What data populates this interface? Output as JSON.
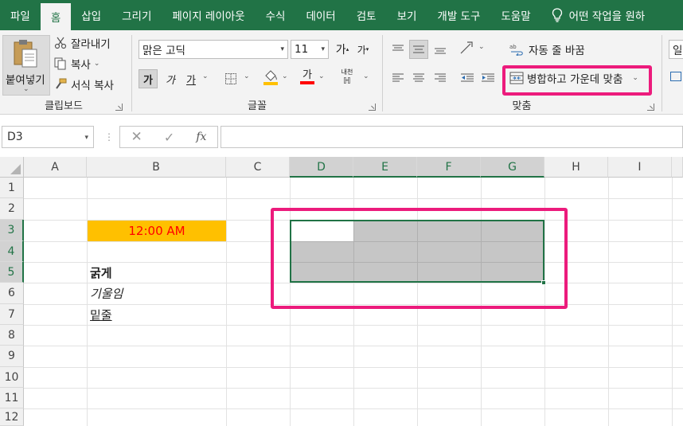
{
  "tabs": [
    {
      "label": "파일"
    },
    {
      "label": "홈",
      "active": true
    },
    {
      "label": "삽입"
    },
    {
      "label": "그리기"
    },
    {
      "label": "페이지 레이아웃"
    },
    {
      "label": "수식"
    },
    {
      "label": "데이터"
    },
    {
      "label": "검토"
    },
    {
      "label": "보기"
    },
    {
      "label": "개발 도구"
    },
    {
      "label": "도움말"
    }
  ],
  "tell_me": "어떤 작업을 원하",
  "clipboard": {
    "paste_label": "붙여넣기",
    "cut_label": "잘라내기",
    "copy_label": "복사",
    "format_painter_label": "서식 복사",
    "group_label": "클립보드"
  },
  "font": {
    "font_name": "맑은 고딕",
    "font_size": "11",
    "grow_label": "가",
    "shrink_label": "가",
    "bold_label": "가",
    "italic_label": "가",
    "underline_label": "가",
    "color_label": "가",
    "phonetic_label": "내천",
    "group_label": "글꼴"
  },
  "alignment": {
    "wrap_text_label": "자동 줄 바꿈",
    "merge_center_label": "병합하고 가운데 맞춤",
    "group_label": "맞춤"
  },
  "number_format_partial": "일",
  "formula_bar": {
    "name_box": "D3",
    "fx": "fx",
    "formula": ""
  },
  "grid": {
    "columns": [
      "A",
      "B",
      "C",
      "D",
      "E",
      "F",
      "G",
      "H",
      "I"
    ],
    "selected_columns": [
      "D",
      "E",
      "F",
      "G"
    ],
    "rows": [
      "1",
      "2",
      "3",
      "4",
      "5",
      "6",
      "7",
      "8",
      "9",
      "10",
      "11",
      "12"
    ],
    "selected_rows": [
      "3",
      "4",
      "5"
    ],
    "cells": {
      "B3": "12:00 AM",
      "B5": "굵게",
      "B6": "기울임",
      "B7": "밑줄"
    },
    "active_cell": "D3",
    "selection_range": "D3:G5"
  },
  "colors": {
    "excel_green": "#217346",
    "highlight": "#ec1b7c",
    "b3_fill": "#ffc000",
    "b3_text": "#ff0000",
    "selection_fill": "#c6c6c6"
  }
}
